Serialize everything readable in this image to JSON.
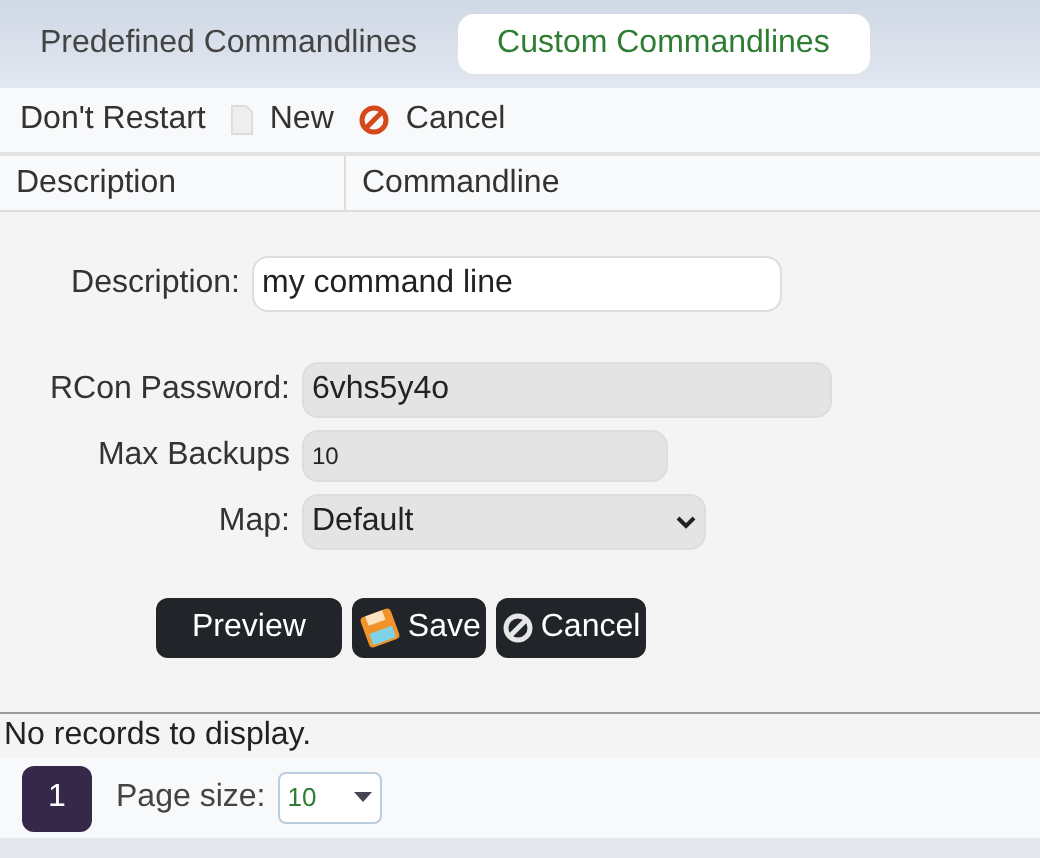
{
  "tabs": [
    {
      "label": "Predefined Commandlines",
      "selected": false
    },
    {
      "label": "Custom Commandlines",
      "selected": true
    }
  ],
  "toolbar": [
    {
      "kind": "text",
      "label": "Don't Restart"
    },
    {
      "kind": "new",
      "label": "New"
    },
    {
      "kind": "cancel",
      "label": "Cancel"
    }
  ],
  "table": {
    "columns": [
      "Description",
      "Commandline"
    ]
  },
  "form": {
    "fields": [
      {
        "kind": "text",
        "label": "Description:",
        "value": "my command line"
      },
      {
        "kind": "readonly",
        "label": "RCon Password:",
        "value": "6vhs5y4o"
      },
      {
        "kind": "small",
        "label": "Max Backups",
        "value": "10"
      },
      {
        "kind": "select",
        "label": "Map:",
        "value": "Default"
      }
    ],
    "buttons": [
      {
        "kind": "preview",
        "label": "Preview"
      },
      {
        "kind": "save",
        "label": "Save"
      },
      {
        "kind": "cancel",
        "label": "Cancel"
      }
    ]
  },
  "empty_message": "No records to display.",
  "pager": {
    "pages": [
      {
        "label": "1",
        "selected": true
      }
    ],
    "page_size_label": "Page size:",
    "page_size": "10"
  }
}
